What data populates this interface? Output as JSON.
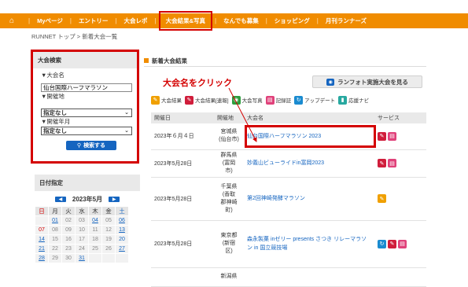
{
  "colors": {
    "accent": "#f08c00",
    "annotation": "#d40000",
    "link": "#1565c0"
  },
  "nav": [
    {
      "label": "Myページ",
      "active": false
    },
    {
      "label": "エントリー",
      "active": false
    },
    {
      "label": "大会レポ",
      "active": false
    },
    {
      "label": "大会結果&写真",
      "active": true
    },
    {
      "label": "なんでも募集",
      "active": false
    },
    {
      "label": "ショッピング",
      "active": false
    },
    {
      "label": "月刊ランナーズ",
      "active": false
    }
  ],
  "breadcrumb": {
    "home": "RUNNET トップ",
    "sep": ">",
    "current": "新着大会一覧"
  },
  "sidebar": {
    "search": {
      "title": "大会検索",
      "name_label": "▼大会名",
      "name_value": "仙台国際ハーフマラソン",
      "place_label": "▼開催地",
      "place_value": "指定なし",
      "month_label": "▼開催年月",
      "month_value": "指定なし",
      "button_label": "検索する"
    },
    "calendar": {
      "title": "日付指定",
      "month": "2023年5月",
      "weekdays": [
        "日",
        "月",
        "火",
        "水",
        "木",
        "金",
        "土"
      ],
      "weeks": [
        [
          "",
          "01",
          "02",
          "03",
          "04",
          "05",
          "06"
        ],
        [
          "07",
          "08",
          "09",
          "10",
          "11",
          "12",
          "13"
        ],
        [
          "14",
          "15",
          "16",
          "17",
          "18",
          "19",
          "20"
        ],
        [
          "21",
          "22",
          "23",
          "24",
          "25",
          "26",
          "27"
        ],
        [
          "28",
          "29",
          "30",
          "31",
          "",
          "",
          ""
        ]
      ],
      "linked": [
        "01",
        "04",
        "06",
        "13",
        "14",
        "21",
        "27",
        "28",
        "31"
      ]
    }
  },
  "main": {
    "title": "新着大会結果",
    "runphoto_button": "ランフォト実施大会を見る",
    "annotation": "大会名をクリック",
    "legend": [
      {
        "icon": "pencil-orange",
        "label": "大会結果"
      },
      {
        "icon": "pencil-red",
        "label": "大会結果[速報]"
      },
      {
        "icon": "camera-green",
        "label": "大会写真"
      },
      {
        "icon": "doc-pink",
        "label": "記録証"
      },
      {
        "icon": "update-blue",
        "label": "アップデート"
      },
      {
        "icon": "cheer-teal",
        "label": "応援ナビ"
      }
    ],
    "table": {
      "headers": [
        "開催日",
        "開催地",
        "大会名",
        "サービス"
      ],
      "rows": [
        {
          "date": "2023年６月４日",
          "venue": [
            "宮城県",
            "(仙台市)"
          ],
          "race": "仙台国際ハーフマラソン 2023",
          "highlight": true,
          "services": [
            "pencil-red",
            "doc-pink"
          ]
        },
        {
          "date": "2023年5月28日",
          "venue": [
            "群馬県",
            "(富岡",
            "市)"
          ],
          "race": "妙義山ビューライドin富岡2023",
          "highlight": false,
          "services": [
            "pencil-red",
            "doc-pink"
          ]
        },
        {
          "date": "2023年5月28日",
          "venue": [
            "千葉県",
            "(香取",
            "郡神崎",
            "町)"
          ],
          "race": "第2回神崎発酵マラソン",
          "highlight": false,
          "services": [
            "pencil-orange"
          ]
        },
        {
          "date": "2023年5月28日",
          "venue": [
            "東京都",
            "(新宿",
            "区)"
          ],
          "race": "森永製菓 inゼリー presents さつき リレーマラソン in 国立競技場",
          "highlight": false,
          "services": [
            "update-blue",
            "pencil-red",
            "doc-pink"
          ]
        },
        {
          "date": "",
          "venue": [
            "新潟県"
          ],
          "race": "",
          "highlight": false,
          "services": []
        }
      ]
    }
  }
}
